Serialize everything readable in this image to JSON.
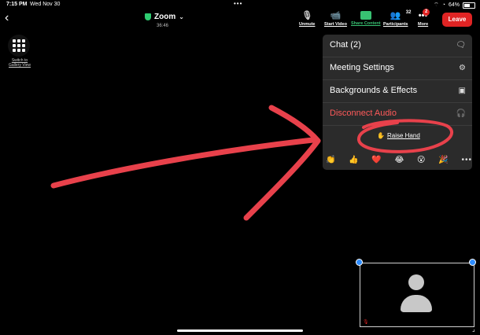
{
  "status_bar": {
    "time": "7:15 PM",
    "date": "Wed Nov 30",
    "battery": "64%"
  },
  "meeting": {
    "name": "Zoom",
    "elapsed": "36:46"
  },
  "toolbar": {
    "unmute": "Unmute",
    "start_video": "Start Video",
    "share_content": "Share Content",
    "participants": "Participants",
    "participants_count": "32",
    "more": "More",
    "more_badge": "2",
    "leave": "Leave"
  },
  "gallery": {
    "label": "Switch to Gallery View"
  },
  "menu": {
    "chat": "Chat (2)",
    "meeting_settings": "Meeting Settings",
    "backgrounds": "Backgrounds & Effects",
    "disconnect_audio": "Disconnect Audio",
    "raise_hand": "Raise Hand",
    "reactions": [
      "👏",
      "👍",
      "❤️",
      "😂",
      "😮",
      "🎉"
    ]
  },
  "colors": {
    "leave_red": "#e02424",
    "share_green": "#38c172",
    "disconnect_red": "#ff5a5a",
    "annotation_red": "#e8414b",
    "menu_bg": "#2b2b2b"
  },
  "icons": {
    "back": "chevron-left-icon",
    "chat": "chat-bubble-icon",
    "settings": "gear-icon",
    "backgrounds": "person-frame-icon",
    "disconnect": "headphones-icon"
  }
}
